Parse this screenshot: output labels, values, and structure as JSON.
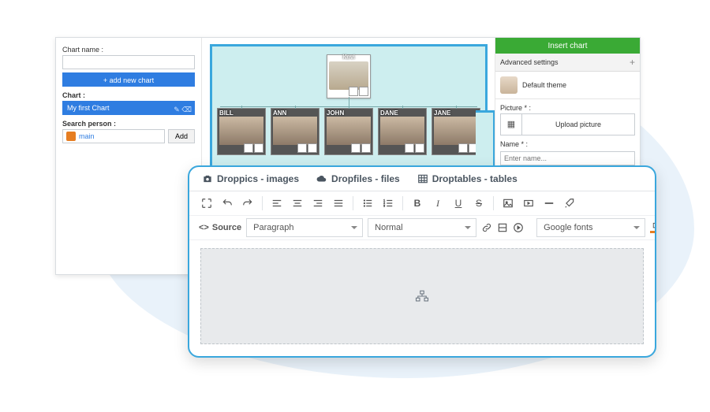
{
  "left": {
    "chart_name_label": "Chart name :",
    "add_new_chart": "+ add new chart",
    "chart_label": "Chart :",
    "selected_chart": "My first Chart",
    "search_label": "Search person :",
    "search_value": "main",
    "add_btn": "Add"
  },
  "org": {
    "root": "Kevi",
    "children": [
      "BILL",
      "ANN",
      "JOHN",
      "DANE",
      "JANE"
    ]
  },
  "right": {
    "insert": "Insert chart",
    "advanced": "Advanced settings",
    "theme": "Default theme",
    "picture_label": "Picture * :",
    "upload": "Upload picture",
    "name_label": "Name * :",
    "name_placeholder": "Enter name..."
  },
  "editor": {
    "tabs": {
      "pics": "Droppics - images",
      "files": "Dropfiles - files",
      "tables": "Droptables - tables"
    },
    "source": "Source",
    "dd_paragraph": "Paragraph",
    "dd_normal": "Normal",
    "dd_fonts": "Google fonts"
  }
}
